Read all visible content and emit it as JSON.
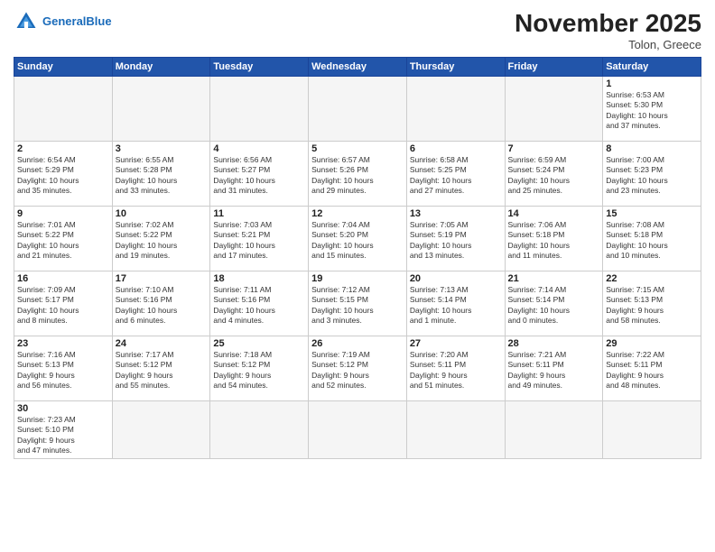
{
  "header": {
    "logo_general": "General",
    "logo_blue": "Blue",
    "month_title": "November 2025",
    "location": "Tolon, Greece"
  },
  "weekdays": [
    "Sunday",
    "Monday",
    "Tuesday",
    "Wednesday",
    "Thursday",
    "Friday",
    "Saturday"
  ],
  "days": [
    {
      "num": "",
      "info": ""
    },
    {
      "num": "",
      "info": ""
    },
    {
      "num": "",
      "info": ""
    },
    {
      "num": "",
      "info": ""
    },
    {
      "num": "",
      "info": ""
    },
    {
      "num": "",
      "info": ""
    },
    {
      "num": "1",
      "info": "Sunrise: 6:53 AM\nSunset: 5:30 PM\nDaylight: 10 hours\nand 37 minutes."
    },
    {
      "num": "2",
      "info": "Sunrise: 6:54 AM\nSunset: 5:29 PM\nDaylight: 10 hours\nand 35 minutes."
    },
    {
      "num": "3",
      "info": "Sunrise: 6:55 AM\nSunset: 5:28 PM\nDaylight: 10 hours\nand 33 minutes."
    },
    {
      "num": "4",
      "info": "Sunrise: 6:56 AM\nSunset: 5:27 PM\nDaylight: 10 hours\nand 31 minutes."
    },
    {
      "num": "5",
      "info": "Sunrise: 6:57 AM\nSunset: 5:26 PM\nDaylight: 10 hours\nand 29 minutes."
    },
    {
      "num": "6",
      "info": "Sunrise: 6:58 AM\nSunset: 5:25 PM\nDaylight: 10 hours\nand 27 minutes."
    },
    {
      "num": "7",
      "info": "Sunrise: 6:59 AM\nSunset: 5:24 PM\nDaylight: 10 hours\nand 25 minutes."
    },
    {
      "num": "8",
      "info": "Sunrise: 7:00 AM\nSunset: 5:23 PM\nDaylight: 10 hours\nand 23 minutes."
    },
    {
      "num": "9",
      "info": "Sunrise: 7:01 AM\nSunset: 5:22 PM\nDaylight: 10 hours\nand 21 minutes."
    },
    {
      "num": "10",
      "info": "Sunrise: 7:02 AM\nSunset: 5:22 PM\nDaylight: 10 hours\nand 19 minutes."
    },
    {
      "num": "11",
      "info": "Sunrise: 7:03 AM\nSunset: 5:21 PM\nDaylight: 10 hours\nand 17 minutes."
    },
    {
      "num": "12",
      "info": "Sunrise: 7:04 AM\nSunset: 5:20 PM\nDaylight: 10 hours\nand 15 minutes."
    },
    {
      "num": "13",
      "info": "Sunrise: 7:05 AM\nSunset: 5:19 PM\nDaylight: 10 hours\nand 13 minutes."
    },
    {
      "num": "14",
      "info": "Sunrise: 7:06 AM\nSunset: 5:18 PM\nDaylight: 10 hours\nand 11 minutes."
    },
    {
      "num": "15",
      "info": "Sunrise: 7:08 AM\nSunset: 5:18 PM\nDaylight: 10 hours\nand 10 minutes."
    },
    {
      "num": "16",
      "info": "Sunrise: 7:09 AM\nSunset: 5:17 PM\nDaylight: 10 hours\nand 8 minutes."
    },
    {
      "num": "17",
      "info": "Sunrise: 7:10 AM\nSunset: 5:16 PM\nDaylight: 10 hours\nand 6 minutes."
    },
    {
      "num": "18",
      "info": "Sunrise: 7:11 AM\nSunset: 5:16 PM\nDaylight: 10 hours\nand 4 minutes."
    },
    {
      "num": "19",
      "info": "Sunrise: 7:12 AM\nSunset: 5:15 PM\nDaylight: 10 hours\nand 3 minutes."
    },
    {
      "num": "20",
      "info": "Sunrise: 7:13 AM\nSunset: 5:14 PM\nDaylight: 10 hours\nand 1 minute."
    },
    {
      "num": "21",
      "info": "Sunrise: 7:14 AM\nSunset: 5:14 PM\nDaylight: 10 hours\nand 0 minutes."
    },
    {
      "num": "22",
      "info": "Sunrise: 7:15 AM\nSunset: 5:13 PM\nDaylight: 9 hours\nand 58 minutes."
    },
    {
      "num": "23",
      "info": "Sunrise: 7:16 AM\nSunset: 5:13 PM\nDaylight: 9 hours\nand 56 minutes."
    },
    {
      "num": "24",
      "info": "Sunrise: 7:17 AM\nSunset: 5:12 PM\nDaylight: 9 hours\nand 55 minutes."
    },
    {
      "num": "25",
      "info": "Sunrise: 7:18 AM\nSunset: 5:12 PM\nDaylight: 9 hours\nand 54 minutes."
    },
    {
      "num": "26",
      "info": "Sunrise: 7:19 AM\nSunset: 5:12 PM\nDaylight: 9 hours\nand 52 minutes."
    },
    {
      "num": "27",
      "info": "Sunrise: 7:20 AM\nSunset: 5:11 PM\nDaylight: 9 hours\nand 51 minutes."
    },
    {
      "num": "28",
      "info": "Sunrise: 7:21 AM\nSunset: 5:11 PM\nDaylight: 9 hours\nand 49 minutes."
    },
    {
      "num": "29",
      "info": "Sunrise: 7:22 AM\nSunset: 5:11 PM\nDaylight: 9 hours\nand 48 minutes."
    },
    {
      "num": "30",
      "info": "Sunrise: 7:23 AM\nSunset: 5:10 PM\nDaylight: 9 hours\nand 47 minutes."
    },
    {
      "num": "",
      "info": ""
    },
    {
      "num": "",
      "info": ""
    },
    {
      "num": "",
      "info": ""
    },
    {
      "num": "",
      "info": ""
    },
    {
      "num": "",
      "info": ""
    },
    {
      "num": "",
      "info": ""
    }
  ]
}
